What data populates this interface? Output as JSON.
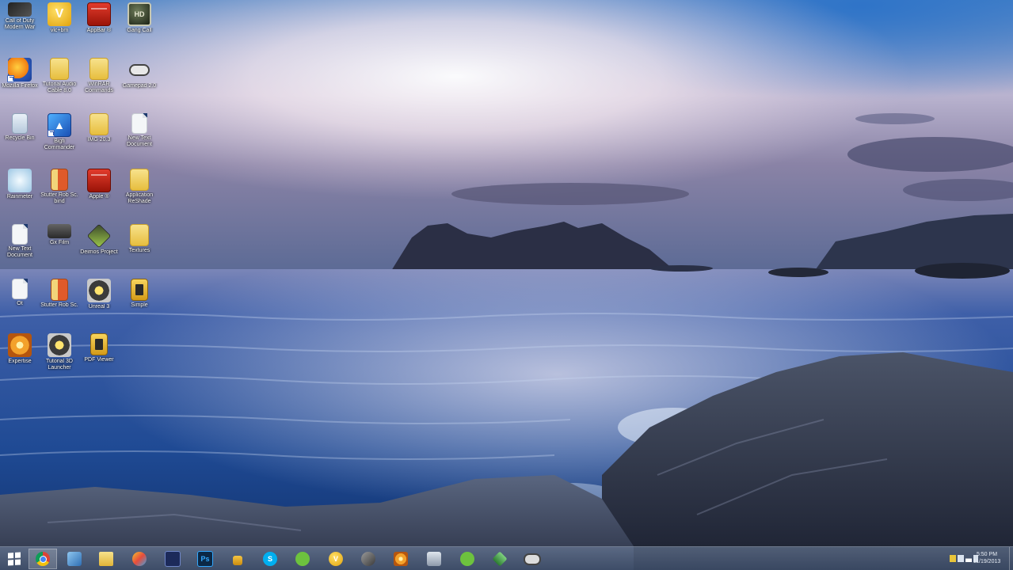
{
  "desktop": {
    "icons": [
      {
        "label": "Call of Duty Modern War",
        "icon": "game-icon"
      },
      {
        "label": "vlc+bm",
        "icon": "v-app-icon"
      },
      {
        "label": "AppBar ®",
        "icon": "red-app-icon"
      },
      {
        "label": "Gang Call",
        "icon": "hd-app-icon"
      },
      {
        "label": "Mozilla Firefox",
        "icon": "firefox-icon"
      },
      {
        "label": "Tutorial Audio Cable 8.0",
        "icon": "folder-icon"
      },
      {
        "label": "WinRAR Commands",
        "icon": "folder-icon"
      },
      {
        "label": "Gamepad 2.0",
        "icon": "gamepad-icon"
      },
      {
        "label": "Recycle Bin",
        "icon": "recycle-bin-icon"
      },
      {
        "label": "Bigfi Commander",
        "icon": "blue-app-icon"
      },
      {
        "label": "IMG 20.3",
        "icon": "folder-icon"
      },
      {
        "label": "New Text Document",
        "icon": "document-icon"
      },
      {
        "label": "Rainmeter",
        "icon": "swirl-app-icon"
      },
      {
        "label": "Stutter Rob Sc. bind",
        "icon": "book-icon"
      },
      {
        "label": "Apple ®",
        "icon": "red-app-icon"
      },
      {
        "label": "Application ReShade",
        "icon": "folder-icon"
      },
      {
        "label": "New Text Document",
        "icon": "document-icon"
      },
      {
        "label": "Gx Film",
        "icon": "camera-icon"
      },
      {
        "label": "Deimos Project",
        "icon": "cube-icon"
      },
      {
        "label": "Textures",
        "icon": "folder-icon"
      },
      {
        "label": "Ot",
        "icon": "document-icon"
      },
      {
        "label": "Stutter Rob Sc.",
        "icon": "book-icon"
      },
      {
        "label": "Unreal 3",
        "icon": "gauge-icon"
      },
      {
        "label": "Simple",
        "icon": "pdf-icon"
      },
      {
        "label": "Expertise",
        "icon": "starburst-icon"
      },
      {
        "label": "Tutorial 3D Launcher",
        "icon": "gauge-icon"
      },
      {
        "label": "PDF Viewer",
        "icon": "pdf-icon"
      }
    ]
  },
  "taskbar": {
    "apps": [
      {
        "name": "chrome",
        "icon": "chrome-icon",
        "active": true
      },
      {
        "name": "network",
        "icon": "network-icon"
      },
      {
        "name": "explorer",
        "icon": "folder-icon"
      },
      {
        "name": "paint",
        "icon": "paint-icon"
      },
      {
        "name": "media",
        "icon": "media-icon"
      },
      {
        "name": "photoshop",
        "icon": "photoshop-icon",
        "text": "Ps"
      },
      {
        "name": "lock",
        "icon": "lock-icon"
      },
      {
        "name": "skype",
        "icon": "skype-icon",
        "text": "S"
      },
      {
        "name": "spotify",
        "icon": "spotify-icon"
      },
      {
        "name": "v-app",
        "icon": "v-app-icon",
        "text": "V"
      },
      {
        "name": "tool",
        "icon": "tool-icon"
      },
      {
        "name": "game",
        "icon": "starburst-icon"
      },
      {
        "name": "window",
        "icon": "window-icon"
      },
      {
        "name": "spotify2",
        "icon": "spotify-icon"
      },
      {
        "name": "diamond",
        "icon": "diamond-icon"
      },
      {
        "name": "gamepad",
        "icon": "gamepad-icon"
      }
    ],
    "clock": {
      "time": "5:50 PM",
      "date": "11/19/2013"
    }
  },
  "colors": {
    "sky_top": "#3a6fb0",
    "sea": "#2c4d8c",
    "taskbar": "#5a6e90",
    "accent_chrome_red": "#db4437",
    "accent_spotify": "#6dc23e"
  }
}
